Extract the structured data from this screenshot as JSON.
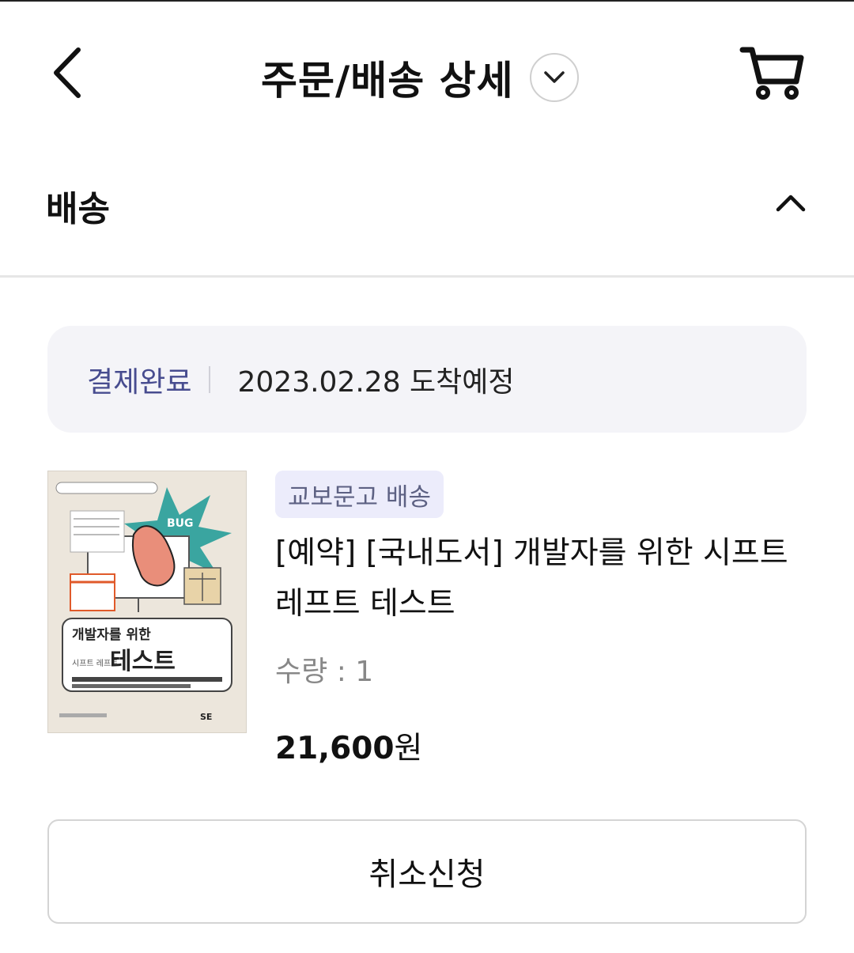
{
  "header": {
    "title": "주문/배송 상세",
    "back_icon": "chevron-left-icon",
    "toggle_icon": "chevron-down-icon",
    "cart_icon": "cart-icon"
  },
  "section": {
    "title": "배송",
    "collapse_icon": "chevron-up-icon"
  },
  "status": {
    "label": "결제완료",
    "date": "2023.02.28 도착예정"
  },
  "product": {
    "badge": "교보문고 배송",
    "name": "[예약] [국내도서] 개발자를 위한 시프트 레프트 테스트",
    "qty_label": "수량",
    "qty_sep": " : ",
    "qty_value": "1",
    "price_number": "21,600",
    "price_unit": "원",
    "cover": {
      "title_line": "개발자를 위한",
      "subtitle_small": "시프트 레프트",
      "title_big": "테스트",
      "bug_label": "BUG",
      "publisher": "SE"
    }
  },
  "actions": {
    "cancel_label": "취소신청"
  },
  "colors": {
    "status_label": "#474c8f",
    "status_bg": "#f4f4f8",
    "badge_bg": "#ececfb",
    "badge_text": "#5d6183"
  }
}
